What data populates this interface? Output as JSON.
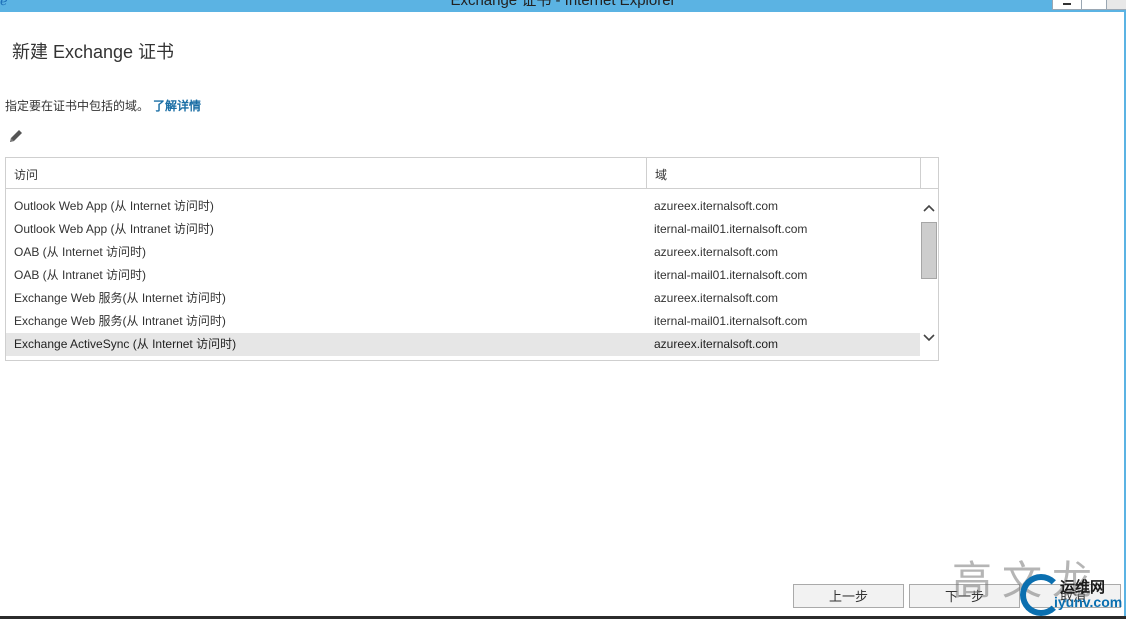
{
  "window": {
    "title": "Exchange 证书 - Internet Explorer"
  },
  "page": {
    "title": "新建 Exchange 证书",
    "instruction": "指定要在证书中包括的域。",
    "learn_more": "了解详情"
  },
  "grid": {
    "headers": [
      "访问",
      "域"
    ],
    "rows": [
      {
        "access": "Outlook Web App (从 Internet 访问时)",
        "domain": "azureex.iternalsoft.com"
      },
      {
        "access": "Outlook Web App (从 Intranet 访问时)",
        "domain": "iternal-mail01.iternalsoft.com"
      },
      {
        "access": "OAB (从 Internet 访问时)",
        "domain": "azureex.iternalsoft.com"
      },
      {
        "access": "OAB (从 Intranet 访问时)",
        "domain": "iternal-mail01.iternalsoft.com"
      },
      {
        "access": "Exchange Web 服务(从 Internet 访问时)",
        "domain": "azureex.iternalsoft.com"
      },
      {
        "access": "Exchange Web 服务(从 Intranet 访问时)",
        "domain": "iternal-mail01.iternalsoft.com"
      },
      {
        "access": "Exchange ActiveSync (从 Internet 访问时)",
        "domain": "azureex.iternalsoft.com",
        "selected": true
      }
    ]
  },
  "buttons": {
    "back": "上一步",
    "next": "下一步",
    "cancel": "取消"
  },
  "watermark": {
    "name": "高文龙",
    "site_top": "运维网",
    "site_bottom": "iyunv.com"
  },
  "colors": {
    "titlebar": "#5bb3e3",
    "link": "#1a6ea5",
    "selected_row": "#e6e6e6"
  }
}
